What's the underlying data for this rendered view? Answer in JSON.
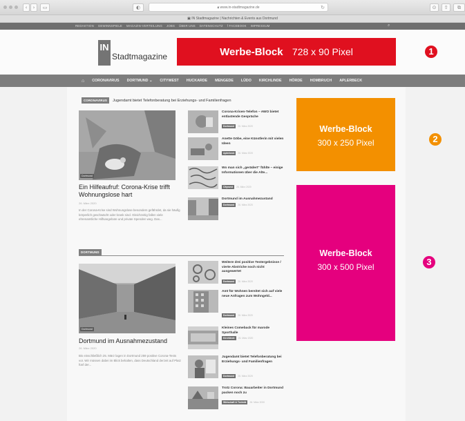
{
  "browser": {
    "url": "www.in-stadtmagazine.de",
    "tab_title": "IN Stadtmagazine | Nachrichten & Events aus Dortmund"
  },
  "topbar": {
    "links": [
      "REDAKTION",
      "GEWINNSPIELE",
      "MAGAZIN-VERTEILUNG",
      "JOBS",
      "ÜBER UNS",
      "DATENSCHUTZ",
      "f FACEBOOK",
      "IMPRESSUM"
    ]
  },
  "header": {
    "logo_letters": "IN",
    "logo_text": "Stadtmagazine"
  },
  "ads": {
    "leaderboard": {
      "title": "Werbe-Block",
      "size": "728 x 90 Pixel",
      "color": "#e0101f",
      "number": "1"
    },
    "rectangle": {
      "title": "Werbe-Block",
      "size": "300 x 250 Pixel",
      "color": "#f39000",
      "number": "2"
    },
    "skyscraper": {
      "title": "Werbe-Block",
      "size": "300 x 500 Pixel",
      "color": "#e5007e",
      "number": "3"
    }
  },
  "nav": {
    "items": [
      "CORONAVIRUS",
      "DORTMUND ⌄",
      "CITYWEST",
      "HUCKARDE",
      "MENGEDE",
      "LÜDO",
      "KIRCHLINDE",
      "HÖRDE",
      "HOMBRUCH",
      "APLERBECK"
    ]
  },
  "breaking": {
    "tag": "CORONAVIRUS",
    "text": "Jugendamt bietet Telefonberatung bei Erziehungs- und Familienfragen"
  },
  "section1": {
    "lead": {
      "image_tag": "Dortmund",
      "title": "Ein Hilfeaufruf: Corona-Krise trifft Wohnungslose hart",
      "date": "26. März 2020",
      "excerpt": "In der Corona-Krise sind Wohnungslose besonders gefährdet, da sie häufig körperlich geschwächt oder krank sind. Gleichzeitig fallen viele ehrenamtliche Hilfsangebote und private Spenden weg. Das..."
    },
    "items": [
      {
        "title": "Corona-Krisen-Telefon – AWO bietet entlastende Gespräche",
        "badge": "Dortmund",
        "date": "26. März 2020"
      },
      {
        "title": "Anette Göbe, eine Künstlerin mit vielen Ideen",
        "badge": "Aplerbeck",
        "date": "26. März 2020"
      },
      {
        "title": "Wo man sich „gerädert“ fühlte – einige Informationen über die Alte...",
        "badge": "Citywest",
        "date": "26. März 2020"
      },
      {
        "title": "Dortmund im Ausnahmezustand",
        "badge": "Dortmund",
        "date": "26. März 2020"
      }
    ]
  },
  "section2": {
    "tag": "DORTMUND",
    "lead": {
      "image_tag": "Dortmund",
      "title": "Dortmund im Ausnahmezustand",
      "date": "26. März 2020",
      "excerpt": "Bis einschließlich 25. März lagen in Dortmund 259 positive Corona-Tests vor. Wir müssen dabei im Blick behalten, dass Deutschland derzeit auf Platz fünf der..."
    },
    "items": [
      {
        "title": "Weitere drei positive Testergebnisse / vierte Abstriche noch nicht ausgewertet",
        "badge": "Dortmund",
        "date": "26. März 2020"
      },
      {
        "title": "Amt für Wohnen bereitet sich auf viele neue Anfragen zum Wohngeld...",
        "badge": "Dortmund",
        "date": "26. März 2020"
      },
      {
        "title": "Kleines Comeback für marode Sporthalle",
        "badge": "Kirchlinde",
        "date": "26. März 2020"
      },
      {
        "title": "Jugendamt bietet Telefonberatung bei Erziehungs- und Familienfragen",
        "badge": "Dortmund",
        "date": "26. März 2020"
      },
      {
        "title": "Trotz Corona: Bauarbeiter in Dortmund packen noch zu",
        "badge": "Wirtschaft & Technik",
        "date": "26. März 2020"
      }
    ]
  }
}
